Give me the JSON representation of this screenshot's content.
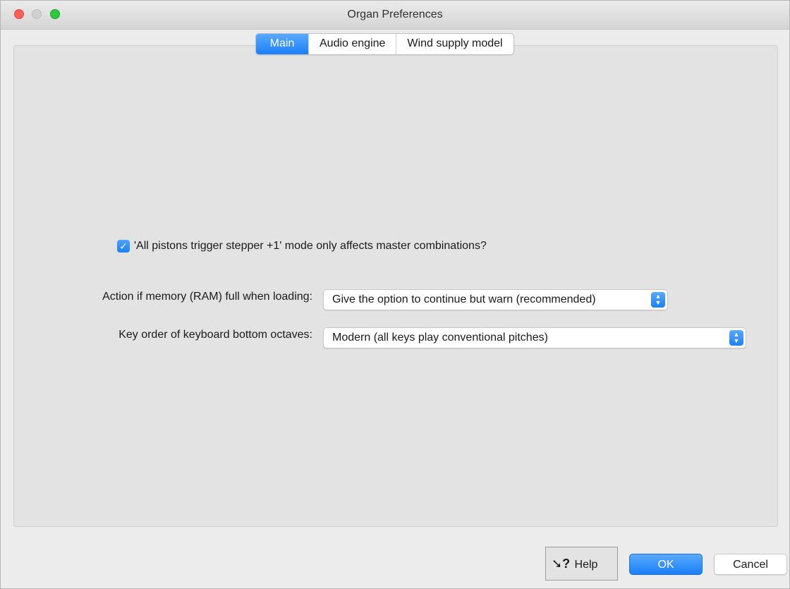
{
  "window": {
    "title": "Organ Preferences"
  },
  "tabs": [
    {
      "label": "Main",
      "active": true
    },
    {
      "label": "Audio engine",
      "active": false
    },
    {
      "label": "Wind supply model",
      "active": false
    }
  ],
  "main": {
    "master_combinations_checkbox": {
      "label": "'All pistons trigger stepper +1' mode only affects master combinations?",
      "checked": true
    },
    "memory_full": {
      "label": "Action if memory (RAM) full when loading:",
      "selected": "Give the option to continue but warn (recommended)"
    },
    "key_order": {
      "label": "Key order of keyboard bottom octaves:",
      "selected": "Modern (all keys play conventional pitches)"
    }
  },
  "footer": {
    "help_label": "Help",
    "ok_label": "OK",
    "cancel_label": "Cancel"
  },
  "icons": {
    "help": "help-cursor-icon",
    "check": "checkmark-icon",
    "stepper": "chevron-up-down-icon"
  },
  "colors": {
    "accent": "#1a7ff7",
    "close": "#fc5f57",
    "maximize": "#2bc840"
  }
}
